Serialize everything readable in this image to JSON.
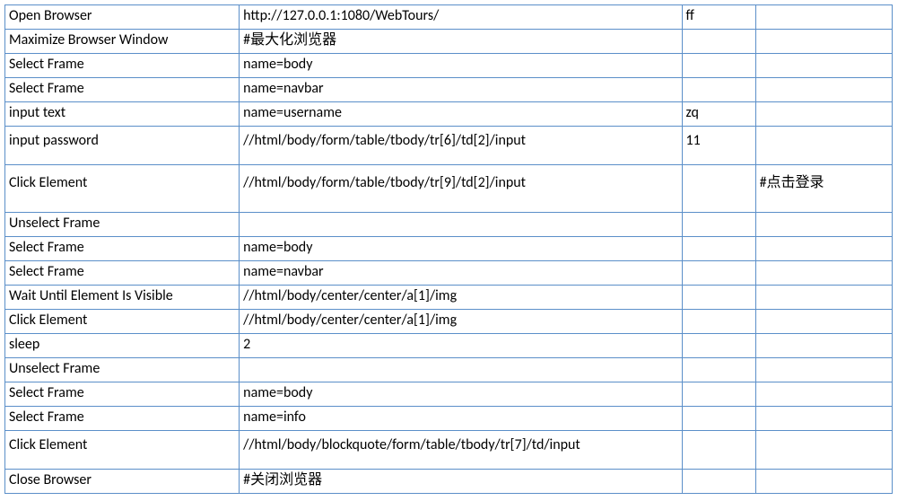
{
  "rows": [
    {
      "c0": "Open Browser",
      "c1": "http://127.0.0.1:1080/WebTours/",
      "c2": "ff",
      "c3": ""
    },
    {
      "c0": "Maximize Browser Window",
      "c1": "#最大化浏览器",
      "c2": "",
      "c3": ""
    },
    {
      "c0": "Select Frame",
      "c1": "name=body",
      "c2": "",
      "c3": ""
    },
    {
      "c0": "Select Frame",
      "c1": "name=navbar",
      "c2": "",
      "c3": ""
    },
    {
      "c0": "input text",
      "c1": "name=username",
      "c2": "zq",
      "c3": ""
    },
    {
      "c0": "input password",
      "c1": "//html/body/form/table/tbody/tr[6]/td[2]/input",
      "c2": "11",
      "c3": "",
      "cls": "med"
    },
    {
      "c0": "Click Element",
      "c1": "//html/body/form/table/tbody/tr[9]/td[2]/input",
      "c2": "",
      "c3": "#点击登录",
      "cls": "tall"
    },
    {
      "c0": "Unselect Frame",
      "c1": "",
      "c2": "",
      "c3": ""
    },
    {
      "c0": "Select Frame",
      "c1": "name=body",
      "c2": "",
      "c3": ""
    },
    {
      "c0": "Select Frame",
      "c1": "name=navbar",
      "c2": "",
      "c3": ""
    },
    {
      "c0": "Wait Until Element Is Visible",
      "c1": "//html/body/center/center/a[1]/img",
      "c2": "",
      "c3": ""
    },
    {
      "c0": "Click Element",
      "c1": "//html/body/center/center/a[1]/img",
      "c2": "",
      "c3": ""
    },
    {
      "c0": "sleep",
      "c1": "2",
      "c2": "",
      "c3": ""
    },
    {
      "c0": "Unselect Frame",
      "c1": "",
      "c2": "",
      "c3": ""
    },
    {
      "c0": "Select Frame",
      "c1": "name=body",
      "c2": "",
      "c3": ""
    },
    {
      "c0": "Select Frame",
      "c1": "name=info",
      "c2": "",
      "c3": ""
    },
    {
      "c0": "Click Element",
      "c1": "//html/body/blockquote/form/table/tbody/tr[7]/td/input",
      "c2": "",
      "c3": "",
      "cls": "med"
    },
    {
      "c0": "Close Browser",
      "c1": "#关闭浏览器",
      "c2": "",
      "c3": ""
    }
  ]
}
